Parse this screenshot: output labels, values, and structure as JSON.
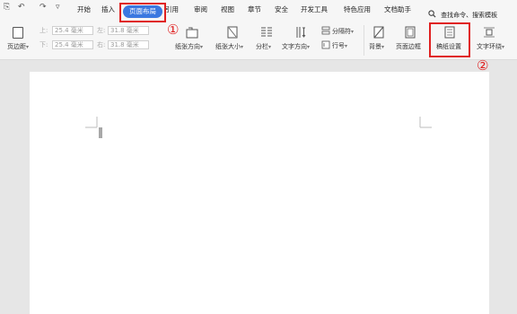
{
  "menubar": {
    "quick_icons": [
      "print-preview-icon",
      "undo-icon",
      "redo-icon",
      "dropdown-icon"
    ],
    "undo_glyph": "↶",
    "redo_glyph": "↷",
    "dropdown_glyph": "▿",
    "preview_glyph": "⎘",
    "tabs": [
      {
        "label": "开始"
      },
      {
        "label": "插入"
      },
      {
        "label": "页面布局",
        "active": true
      },
      {
        "label": "引用"
      },
      {
        "label": "审阅"
      },
      {
        "label": "视图"
      },
      {
        "label": "章节"
      },
      {
        "label": "安全"
      },
      {
        "label": "开发工具"
      },
      {
        "label": "特色应用"
      },
      {
        "label": "文档助手"
      }
    ],
    "search_label": "查找命令、搜索模板"
  },
  "toolbar": {
    "margin_label": "页边距",
    "top_label": "上:",
    "top_value": "25.4 毫米",
    "bottom_label": "下:",
    "bottom_value": "25.4 毫米",
    "left_label": "左:",
    "left_value": "31.8 毫米",
    "right_label": "右:",
    "right_value": "31.8 毫米",
    "orientation_label": "纸张方向",
    "paper_size_label": "纸张大小",
    "columns_label": "分栏",
    "text_direction_label": "文字方向",
    "breaks_label": "分隔符",
    "line_numbers_label": "行号",
    "background_label": "背景",
    "page_border_label": "页面边框",
    "manuscript_label": "稿纸设置",
    "text_wrap_label": "文字环绕",
    "dropdown_arrow": "▾"
  },
  "annotations": {
    "marker_1": "①",
    "marker_2": "②",
    "color": "#e02020"
  },
  "accent_color": "#3b78e0"
}
